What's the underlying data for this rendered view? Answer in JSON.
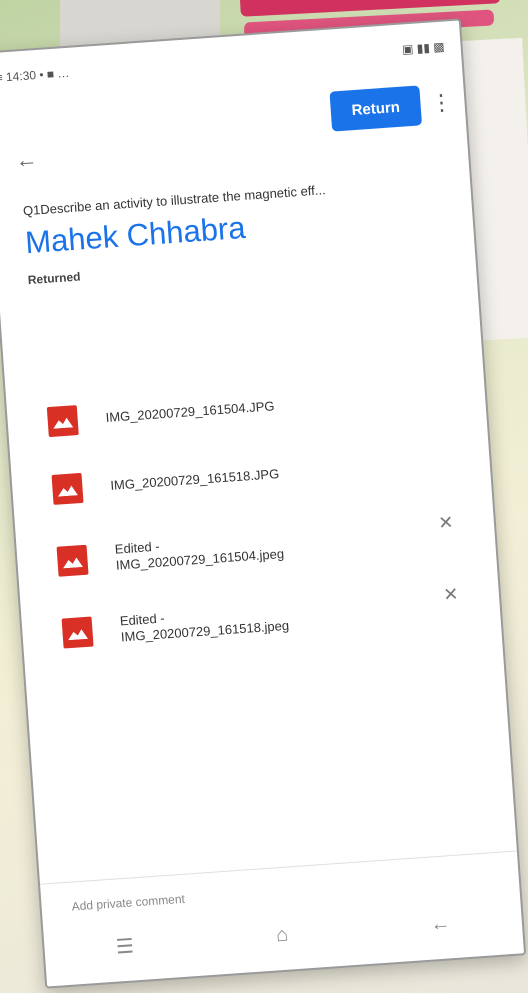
{
  "status_bar": {
    "time": "14:30",
    "left": "   14:30 • ■ …",
    "right": "▣ ▐ ■"
  },
  "toolbar": {
    "return_label": "Return",
    "more_icon": "more-vert-icon",
    "back_icon": "arrow-back-icon"
  },
  "assignment": {
    "question": "Q1Describe an activity to illustrate the magnetic eff...",
    "student_name": "Mahek Chhabra",
    "status": "Returned"
  },
  "files": [
    {
      "name_line1": "IMG_20200729_161504.JPG",
      "name_line2": "",
      "removable": false
    },
    {
      "name_line1": "IMG_20200729_161518.JPG",
      "name_line2": "",
      "removable": false
    },
    {
      "name_line1": "Edited -",
      "name_line2": "IMG_20200729_161504.jpeg",
      "removable": true
    },
    {
      "name_line1": "Edited -",
      "name_line2": "IMG_20200729_161518.jpeg",
      "removable": true
    }
  ],
  "comment": {
    "placeholder": "Add private comment"
  },
  "nav": {
    "menu_icon": "menu-icon",
    "home_icon": "home-icon",
    "back_icon": "back-nav-icon"
  },
  "colors": {
    "accent": "#1a73e8",
    "file_icon": "#d93025"
  }
}
